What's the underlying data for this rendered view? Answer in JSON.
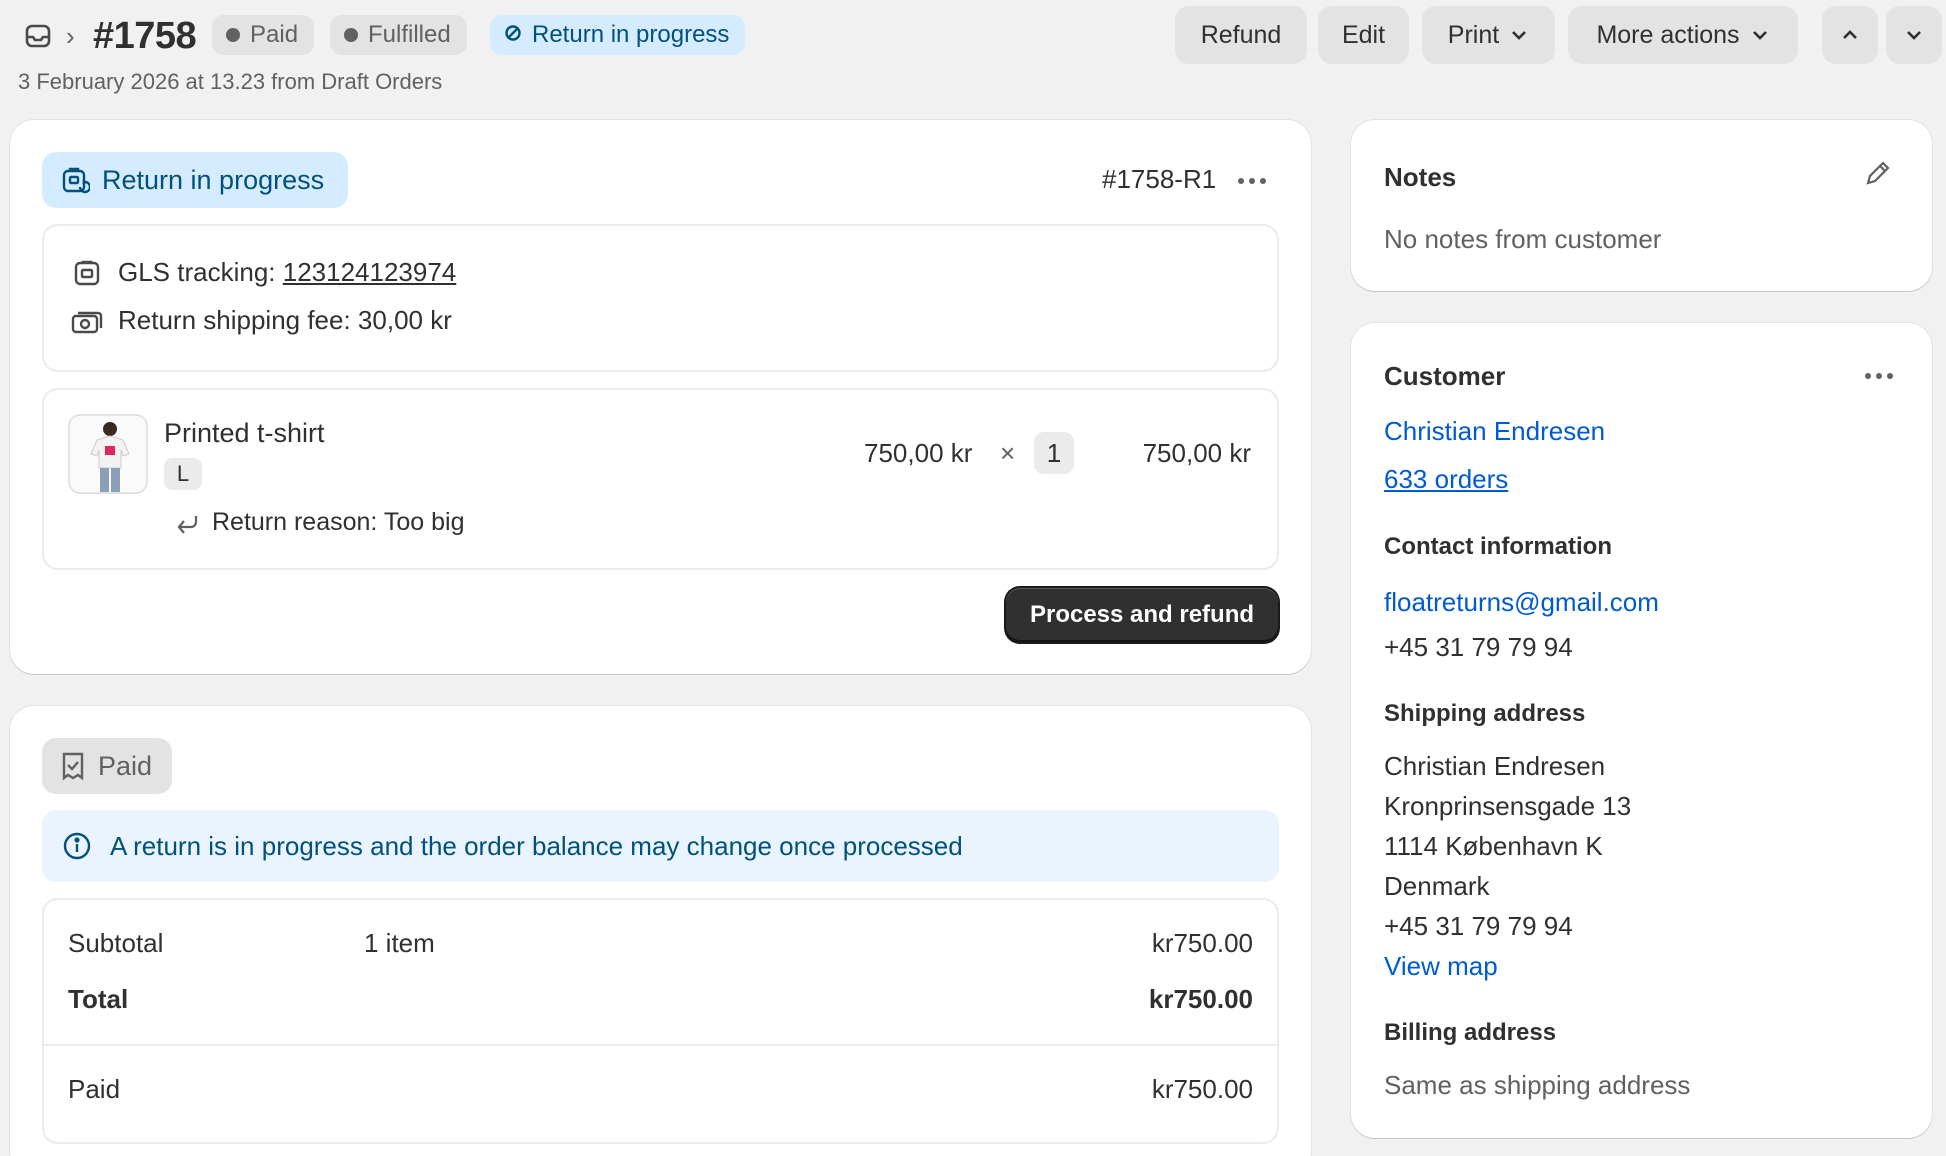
{
  "header": {
    "order_number": "#1758",
    "badges": [
      "Paid",
      "Fulfilled",
      "Return in progress"
    ],
    "subtitle": "3 February 2026 at 13.23 from Draft Orders",
    "buttons": {
      "refund": "Refund",
      "edit": "Edit",
      "print": "Print",
      "more_actions": "More actions"
    }
  },
  "return_card": {
    "status": "Return in progress",
    "return_id": "#1758-R1",
    "tracking_label": "GLS tracking:",
    "tracking_number": "123124123974",
    "shipping_fee": "Return shipping fee: 30,00 kr",
    "item": {
      "name": "Printed t-shirt",
      "variant": "L",
      "unit_price": "750,00 kr",
      "times": "×",
      "quantity": "1",
      "total": "750,00 kr",
      "return_reason": "Return reason: Too big"
    },
    "process_button": "Process and refund"
  },
  "payment_card": {
    "status": "Paid",
    "banner": "A return is in progress and the order balance may change once processed",
    "subtotal_label": "Subtotal",
    "subtotal_items": "1 item",
    "subtotal_value": "kr750.00",
    "total_label": "Total",
    "total_value": "kr750.00",
    "paid_label": "Paid",
    "paid_value": "kr750.00"
  },
  "notes": {
    "title": "Notes",
    "body": "No notes from customer"
  },
  "customer": {
    "title": "Customer",
    "name": "Christian Endresen",
    "orders": "633 orders",
    "contact_title": "Contact information",
    "email": "floatreturns@gmail.com",
    "phone": "+45 31 79 79 94",
    "shipping_title": "Shipping address",
    "address_lines": [
      "Christian Endresen",
      "Kronprinsensgade 13",
      "1114 København K",
      "Denmark",
      "+45 31 79 79 94"
    ],
    "view_map": "View map",
    "billing_title": "Billing address",
    "billing_body": "Same as shipping address"
  },
  "colors": {
    "page_bg": "#f1f1f1",
    "card_bg": "#ffffff",
    "link": "#005bd3",
    "info_badge_bg": "#d5ebff",
    "info_text": "#00527c",
    "primary_button": "#303030"
  }
}
